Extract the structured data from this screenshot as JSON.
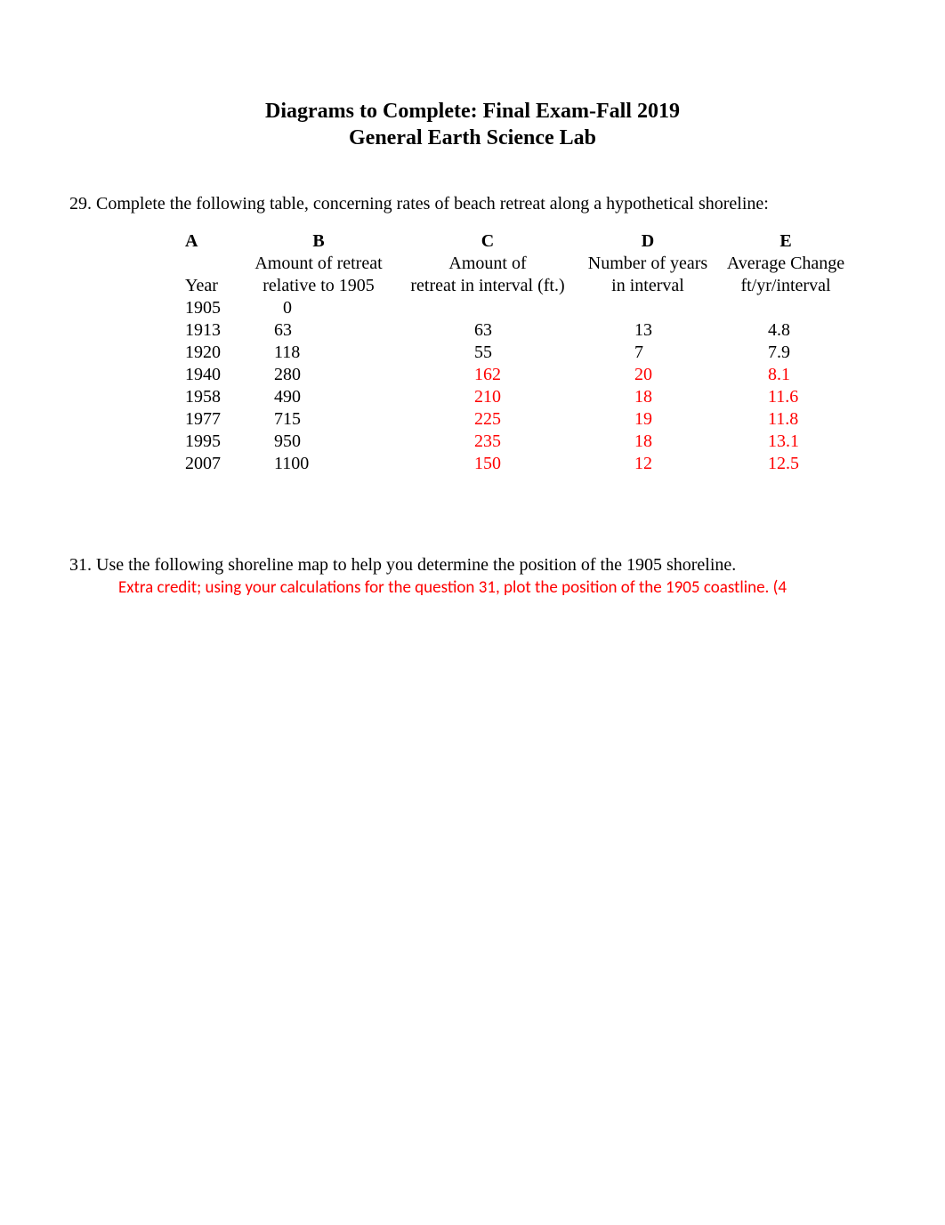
{
  "title": {
    "line1": "Diagrams to Complete: Final Exam-Fall 2019",
    "line2": "General Earth Science Lab"
  },
  "q29": {
    "prompt": "29. Complete the following table, concerning rates of beach retreat along a hypothetical shoreline:",
    "headers": {
      "letters": {
        "a": "A",
        "b": "B",
        "c": "C",
        "d": "D",
        "e": "E"
      },
      "line2": {
        "b": "Amount of retreat",
        "c": "Amount of",
        "d": "Number of years",
        "e": "Average Change"
      },
      "line3": {
        "a": "Year",
        "b": "relative to 1905",
        "c": "retreat in interval (ft.)",
        "d": "in interval",
        "e": "ft/yr/interval"
      }
    },
    "rows": [
      {
        "a": "1905",
        "b": "0",
        "c": "",
        "d": "",
        "e": "",
        "red": false
      },
      {
        "a": "1913",
        "b": "63",
        "c": "63",
        "d": "13",
        "e": "4.8",
        "red": false
      },
      {
        "a": "1920",
        "b": "118",
        "c": "55",
        "d": "7",
        "e": "7.9",
        "red": false
      },
      {
        "a": "1940",
        "b": "280",
        "c": "162",
        "d": "20",
        "e": "8.1",
        "red": true
      },
      {
        "a": "1958",
        "b": "490",
        "c": "210",
        "d": "18",
        "e": "11.6",
        "red": true
      },
      {
        "a": "1977",
        "b": "715",
        "c": "225",
        "d": "19",
        "e": "11.8",
        "red": true
      },
      {
        "a": "1995",
        "b": "950",
        "c": "235",
        "d": "18",
        "e": "13.1",
        "red": true
      },
      {
        "a": "2007",
        "b": "1100",
        "c": "150",
        "d": "12",
        "e": "12.5",
        "red": true
      }
    ]
  },
  "q31": {
    "line1": "31. Use the following shoreline map to help you determine the position of the 1905 shoreline.",
    "line2": "Extra credit; using your calculations for the question 31, plot the position of the 1905 coastline. (4"
  }
}
